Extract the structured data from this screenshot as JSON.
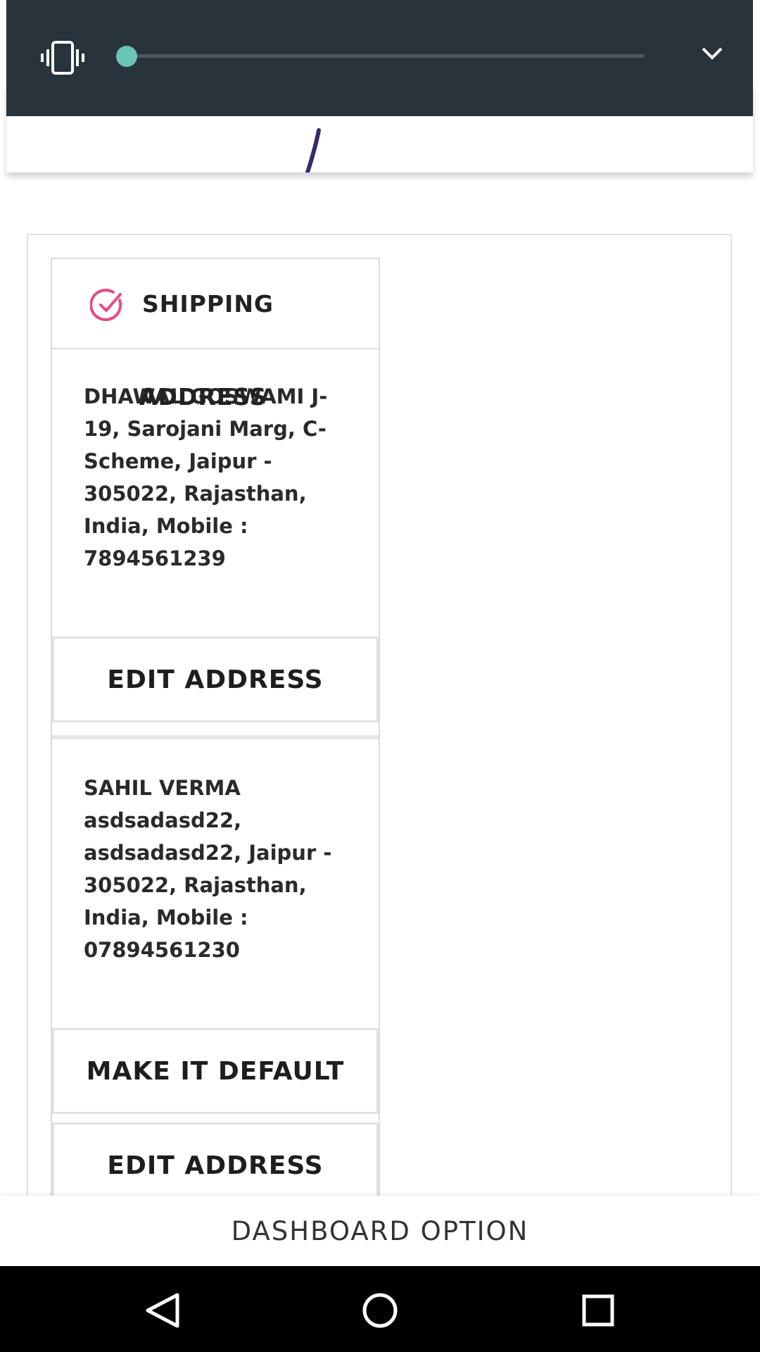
{
  "section": {
    "title_line1": "SHIPPING",
    "title_line2": "ADDRESS"
  },
  "addresses": [
    {
      "text": "DHAWAL GOSWAMI J-19, Sarojani Marg, C-Scheme, Jaipur - 305022, Rajasthan, India, Mobile : 7894561239",
      "buttons": [
        "EDIT ADDRESS"
      ]
    },
    {
      "text": "SAHIL VERMA asdsadasd22, asdsadasd22, Jaipur - 305022, Rajasthan, India, Mobile : 07894561230",
      "buttons": [
        "MAKE IT DEFAULT",
        "EDIT ADDRESS"
      ]
    }
  ],
  "dashboard": {
    "label": "DASHBOARD OPTION"
  },
  "volume": {
    "level": 0.0
  },
  "colors": {
    "accent": "#e84a7f",
    "slider": "#6bc4b8",
    "panel": "#29333b"
  },
  "icons": [
    "vibrate-icon",
    "chevron-down-icon",
    "check-circle-icon",
    "back-icon",
    "home-icon",
    "recents-icon"
  ]
}
